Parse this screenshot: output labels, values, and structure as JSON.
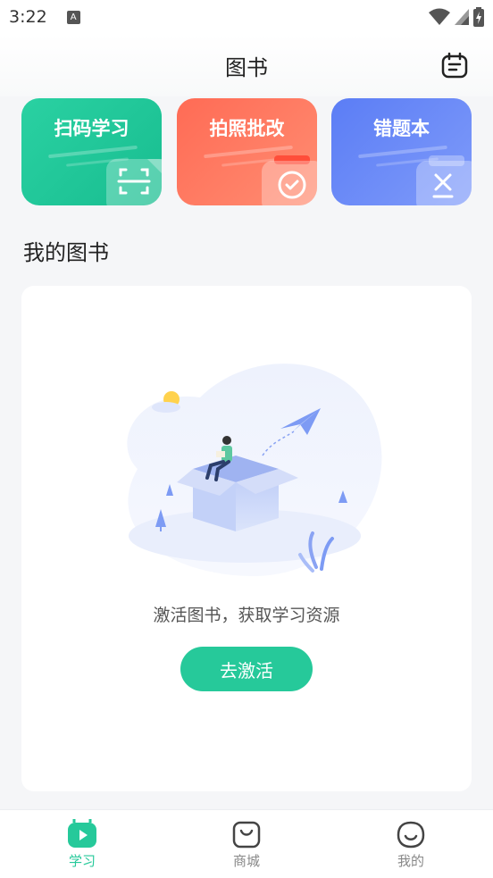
{
  "status_bar": {
    "time": "3:22",
    "indicator": "A"
  },
  "header": {
    "title": "图书"
  },
  "quick_actions": [
    {
      "label": "扫码学习",
      "icon": "scan-icon",
      "color": "#1fc797"
    },
    {
      "label": "拍照批改",
      "icon": "camera-icon",
      "color": "#ff7560"
    },
    {
      "label": "错题本",
      "icon": "wrong-book-icon",
      "color": "#6a89f7"
    }
  ],
  "my_books": {
    "section_title": "我的图书",
    "empty_text": "激活图书，获取学习资源",
    "activate_label": "去激活"
  },
  "bottom_nav": {
    "items": [
      {
        "label": "学习",
        "icon": "study-play-icon",
        "active": true
      },
      {
        "label": "商城",
        "icon": "mall-bag-icon",
        "active": false
      },
      {
        "label": "我的",
        "icon": "profile-face-icon",
        "active": false
      }
    ]
  },
  "colors": {
    "accent": "#26c99a",
    "background": "#f5f6f8"
  }
}
